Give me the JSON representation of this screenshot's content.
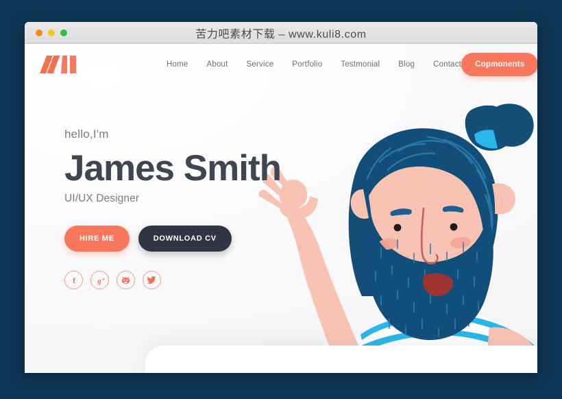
{
  "browser": {
    "title": "苦力吧素材下载 – www.kuli8.com",
    "traffic_lights": [
      "close-red",
      "minimize-yellow",
      "maximize-green"
    ]
  },
  "theme": {
    "accent": "#f9775c",
    "dark": "#2f3542",
    "heading": "#404553",
    "muted": "#7b7b84",
    "hair": "#134e78",
    "skin": "#f9c3b3",
    "stripe": "#29b6e8",
    "page_bg": "#0d3553"
  },
  "nav": {
    "logo_name": "brand-logo-mark",
    "links": [
      {
        "label": "Home"
      },
      {
        "label": "About"
      },
      {
        "label": "Service"
      },
      {
        "label": "Portfolio"
      },
      {
        "label": "Testmonial"
      },
      {
        "label": "Blog"
      },
      {
        "label": "Contact"
      }
    ],
    "cta_label": "Copmonents"
  },
  "hero": {
    "greeting": "hello,I'm",
    "name": "James Smith",
    "role": "UI/UX Designer",
    "primary_button": "HIRE ME",
    "secondary_button": "DOWNLOAD CV",
    "socials": [
      {
        "name": "facebook-icon",
        "glyph": "f"
      },
      {
        "name": "google-plus-icon",
        "glyph": "g+"
      },
      {
        "name": "github-icon",
        "glyph": "cat"
      },
      {
        "name": "twitter-icon",
        "glyph": "bird"
      }
    ]
  },
  "illustration": {
    "name": "bearded-man-waving-illustration",
    "description": "Bearded man with dark blue hair in a man bun, peach skin, OK hand gesture, white shirt with cyan stripes"
  }
}
